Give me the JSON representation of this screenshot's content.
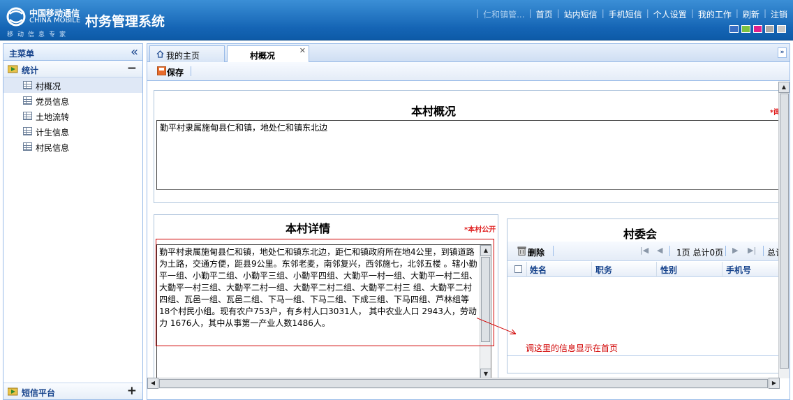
{
  "header": {
    "logo_cn": "中国移动通信",
    "logo_en": "CHINA MOBILE",
    "logo_sub": "移动信息专家",
    "system_title": "村务管理系统",
    "nav": [
      "仁和镇管...",
      "首页",
      "站内短信",
      "手机短信",
      "个人设置",
      "我的工作",
      "刷新",
      "注销"
    ],
    "theme_colors": [
      "#3a6fc4",
      "#7dc242",
      "#e0218a",
      "#a8a8a8",
      "#c8c8c8"
    ]
  },
  "sidebar": {
    "title": "主菜单",
    "group": "统计",
    "items": [
      "村概况",
      "党员信息",
      "土地流转",
      "计生信息",
      "村民信息"
    ],
    "bottom_group": "短信平台"
  },
  "tabs": {
    "home": "我的主页",
    "active": "村概况"
  },
  "toolbar": {
    "save": "保存"
  },
  "overview": {
    "title": "本村概况",
    "text": "勤平村隶属施甸县仁和镇，地处仁和镇东北边"
  },
  "details": {
    "title": "本村详情",
    "public_mark": "*本村公开",
    "text": "勤平村隶属施甸县仁和镇，地处仁和镇东北边，距仁和镇政府所在地4公里，到镇道路为土路，交通方便，距县9公里。东邻老麦，南邻复兴，西邻施七，北邻五楼 。辖小勤平一组、小勤平二组、小勤平三组、小勤平四组、大勤平一村一组、大勤平一村二组、大勤平一村三组、大勤平二村一组、大勤平二村二组、大勤平二村三 组、大勤平二村四组、瓦邑一组、瓦邑二组、下马一组、下马二组、下成三组、下马四组、芦林组等18个村民小组。现有农户753户，有乡村人口3031人，  其中农业人口  2943人，劳动力  1676人，其中从事第一产业人数1486人。"
  },
  "committee": {
    "title": "村委会",
    "delete": "删除",
    "page_info": "1页 总计0页",
    "total": "总记",
    "columns": [
      "姓名",
      "职务",
      "性别",
      "手机号"
    ]
  },
  "annotation": "调这里的信息显示在首页"
}
